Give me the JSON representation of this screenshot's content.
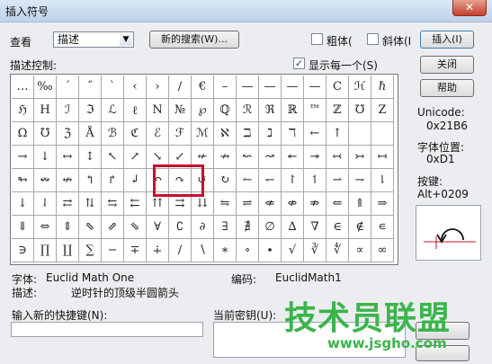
{
  "window": {
    "title": "插入符号",
    "close_glyph": "✕"
  },
  "view": {
    "label": "查看",
    "selected": "描述"
  },
  "buttons": {
    "new_search": "新的搜索(W)...",
    "insert": "插入(I)",
    "close": "关闭",
    "help": "帮助"
  },
  "options": {
    "bold": "粗体(",
    "italic": "斜体(I",
    "show_each": "显示每一个(S)"
  },
  "section_label": "描述控制:",
  "info": {
    "unicode_label": "Unicode:",
    "unicode_value": "0x21B6",
    "font_pos_label": "字体位置:",
    "font_pos_value": "0xD1",
    "key_label": "按键:",
    "key_value": "Alt+0209"
  },
  "grid": {
    "rows": [
      [
        "…",
        "‰",
        "´",
        "˝",
        "ˋ",
        "‹",
        "›",
        "/",
        "€",
        "–",
        "—",
        "—",
        "—",
        "—",
        "C",
        "ℋ",
        "ℏ"
      ],
      [
        "ℌ",
        "H",
        "ℐ",
        "ℑ",
        "ℒ",
        "ℓ",
        "N",
        "№",
        "℘",
        "ℚ",
        "ℛ",
        "ℜ",
        "ℝ",
        "™",
        "ℤ",
        "℧",
        "Z"
      ],
      [
        "Ω",
        "℧",
        "ℨ",
        "Å",
        "ℬ",
        "ℭ",
        "ℰ",
        "ℱ",
        "ℳ",
        "ℵ",
        "ℶ",
        "ℷ",
        "ℸ",
        "←",
        "↑"
      ],
      [
        "→",
        "↓",
        "↔",
        "↕",
        "↖",
        "↗",
        "↘",
        "↙",
        "↚",
        "↛",
        "↜",
        "↝",
        "↞",
        "↠",
        "↢",
        "↣",
        "↤"
      ],
      [
        "↬",
        "↭",
        "↮",
        "↰",
        "↱",
        "↲",
        "↶",
        "↷",
        "↺",
        "↻",
        "↼",
        "↽",
        "↾",
        "↿",
        "⇀",
        "⇁",
        "⇂"
      ],
      [
        "↓",
        "⇃",
        "⇄",
        "⇅",
        "⇆",
        "⇇",
        "⇈",
        "⇉",
        "⇊",
        "⇋",
        "⇌",
        "⇍",
        "⇎",
        "⇏",
        "⇐",
        "⇑",
        "⇒"
      ],
      [
        "⇓",
        "⇔",
        "⇕",
        "⇖",
        "⇗",
        "⇘",
        "∀",
        "∁",
        "∂",
        "∃",
        "∄",
        "∅",
        "∆",
        "∇",
        "∈",
        "∉",
        "∊"
      ],
      [
        "∋",
        "∏",
        "∐",
        "∑",
        "−",
        "∓",
        "∔",
        "∕",
        "∖",
        "∗",
        "∘",
        "∙",
        "√",
        "∛",
        "∜",
        "∝",
        "∞"
      ]
    ]
  },
  "status": {
    "font_label": "字体:",
    "font_value": "Euclid Math One",
    "code_label": "编码:",
    "code_value": "EuclidMath1",
    "desc_label": "描述:",
    "desc_value": "逆时针的顶级半圆箭头"
  },
  "shortcut": {
    "new_label": "输入新的快捷键(N):",
    "new_value": "",
    "current_label": "当前密钥(U):"
  },
  "watermark": {
    "main": "技术员联盟",
    "url": "www.jsgho.com"
  }
}
